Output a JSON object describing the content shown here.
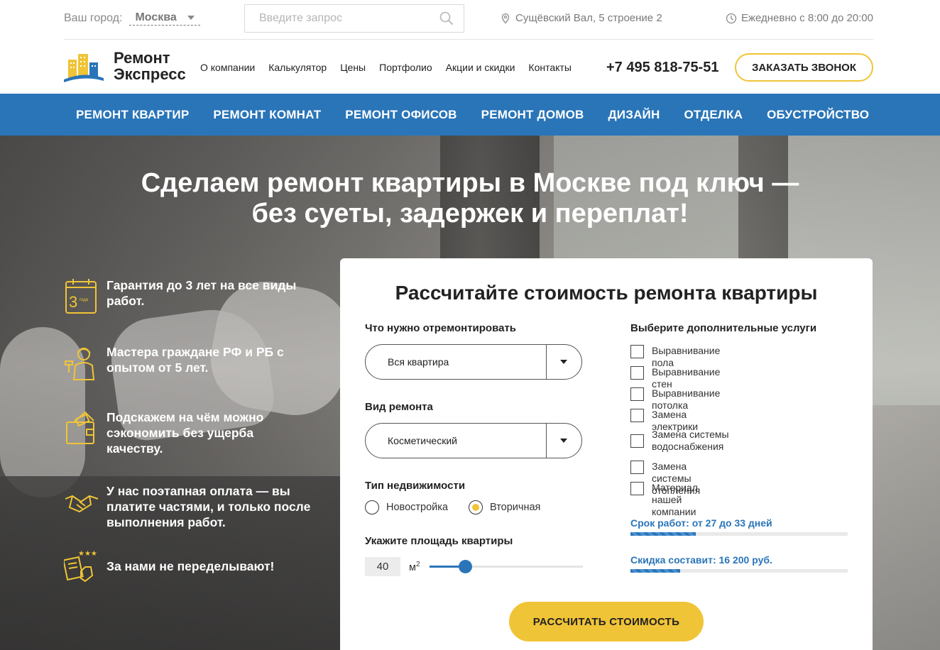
{
  "topbar": {
    "city_label": "Ваш город:",
    "city_value": "Москва",
    "search_placeholder": "Введите запрос",
    "address": "Сущёвский Вал, 5 строение 2",
    "hours": "Ежедневно с 8:00 до 20:00"
  },
  "header": {
    "logo_line1": "Ремонт",
    "logo_line2": "Экспресс",
    "menu": [
      "О компании",
      "Калькулятор",
      "Цены",
      "Портфолио",
      "Акции и скидки",
      "Контакты"
    ],
    "phone": "+7 495 818-75-51",
    "callback_label": "ЗАКАЗАТЬ ЗВОНОК"
  },
  "nav": [
    "РЕМОНТ КВАРТИР",
    "РЕМОНТ КОМНАТ",
    "РЕМОНТ ОФИСОВ",
    "РЕМОНТ ДОМОВ",
    "ДИЗАЙН",
    "ОТДЕЛКА",
    "ОБУСТРОЙСТВО"
  ],
  "hero": {
    "title_line1": "Сделаем ремонт квартиры в Москве под ключ —",
    "title_line2": "без суеты, задержек и переплат!"
  },
  "features": [
    {
      "icon": "calendar-3-years-icon",
      "text": "Гарантия до 3 лет на все виды работ.",
      "badge_number": "3",
      "badge_text": "года"
    },
    {
      "icon": "worker-icon",
      "text": "Мастера граждане РФ и РБ с опытом от 5 лет."
    },
    {
      "icon": "wallet-icon",
      "text": "Подскажем на чём можно сэкономить без ущерба качеству."
    },
    {
      "icon": "handshake-icon",
      "text": "У нас поэтапная оплата — вы платите частями, и только после выполнения работ."
    },
    {
      "icon": "document-stars-icon",
      "text": "За нами не переделывают!"
    }
  ],
  "calculator": {
    "title": "Рассчитайте стоимость ремонта квартиры",
    "what_label": "Что нужно отремонтировать",
    "what_value": "Вся квартира",
    "type_label": "Вид ремонта",
    "type_value": "Косметический",
    "property_label": "Тип недвижимости",
    "property_options": [
      "Новостройка",
      "Вторичная"
    ],
    "property_selected": "Вторичная",
    "area_label": "Укажите площадь квартиры",
    "area_value": "40",
    "area_unit": "м",
    "area_unit_sup": "2",
    "area_slider_fraction": 0.23,
    "extras_label": "Выберите дополнительные услуги",
    "extras": [
      "Выравнивание пола",
      "Выравнивание стен",
      "Выравнивание потолка",
      "Замена электрики",
      "Замена системы водоснабжения",
      "Замена системы отопления",
      "Материал нашей компании"
    ],
    "duration_text": "Срок работ: от 27 до 33 дней",
    "duration_fraction": 0.3,
    "discount_text": "Скидка составит: 16 200 руб.",
    "discount_fraction": 0.23,
    "submit_label": "РАССЧИТАТЬ СТОИМОСТЬ"
  },
  "colors": {
    "accent_blue": "#2a75b8",
    "accent_yellow": "#f0c437"
  }
}
